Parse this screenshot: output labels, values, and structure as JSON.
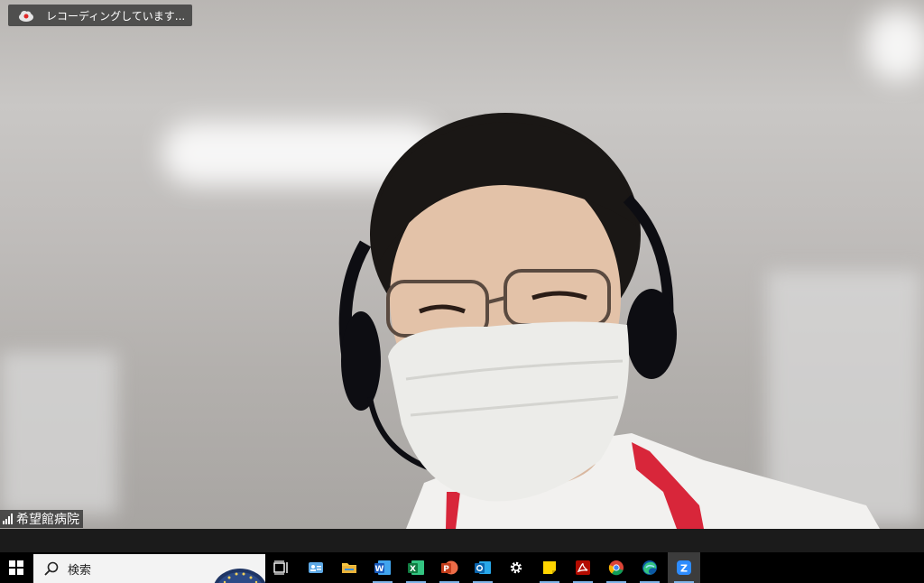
{
  "recording": {
    "label": "レコーディングしています..."
  },
  "participant": {
    "name": "希望館病院"
  },
  "taskbar": {
    "search_placeholder": "検索",
    "apps": [
      {
        "icon": "task-view-icon"
      },
      {
        "icon": "contacts-app-icon"
      },
      {
        "icon": "file-explorer-icon"
      },
      {
        "icon": "word-icon"
      },
      {
        "icon": "excel-icon"
      },
      {
        "icon": "powerpoint-icon"
      },
      {
        "icon": "outlook-icon"
      },
      {
        "icon": "settings-gear-icon"
      },
      {
        "icon": "sticky-notes-icon"
      },
      {
        "icon": "acrobat-icon"
      },
      {
        "icon": "chrome-icon"
      },
      {
        "icon": "edge-icon"
      },
      {
        "icon": "zoom-icon"
      }
    ]
  },
  "colors": {
    "zoom_blue": "#2d8cff",
    "underline": "#7fb4e8",
    "taskbar": "#000000"
  }
}
